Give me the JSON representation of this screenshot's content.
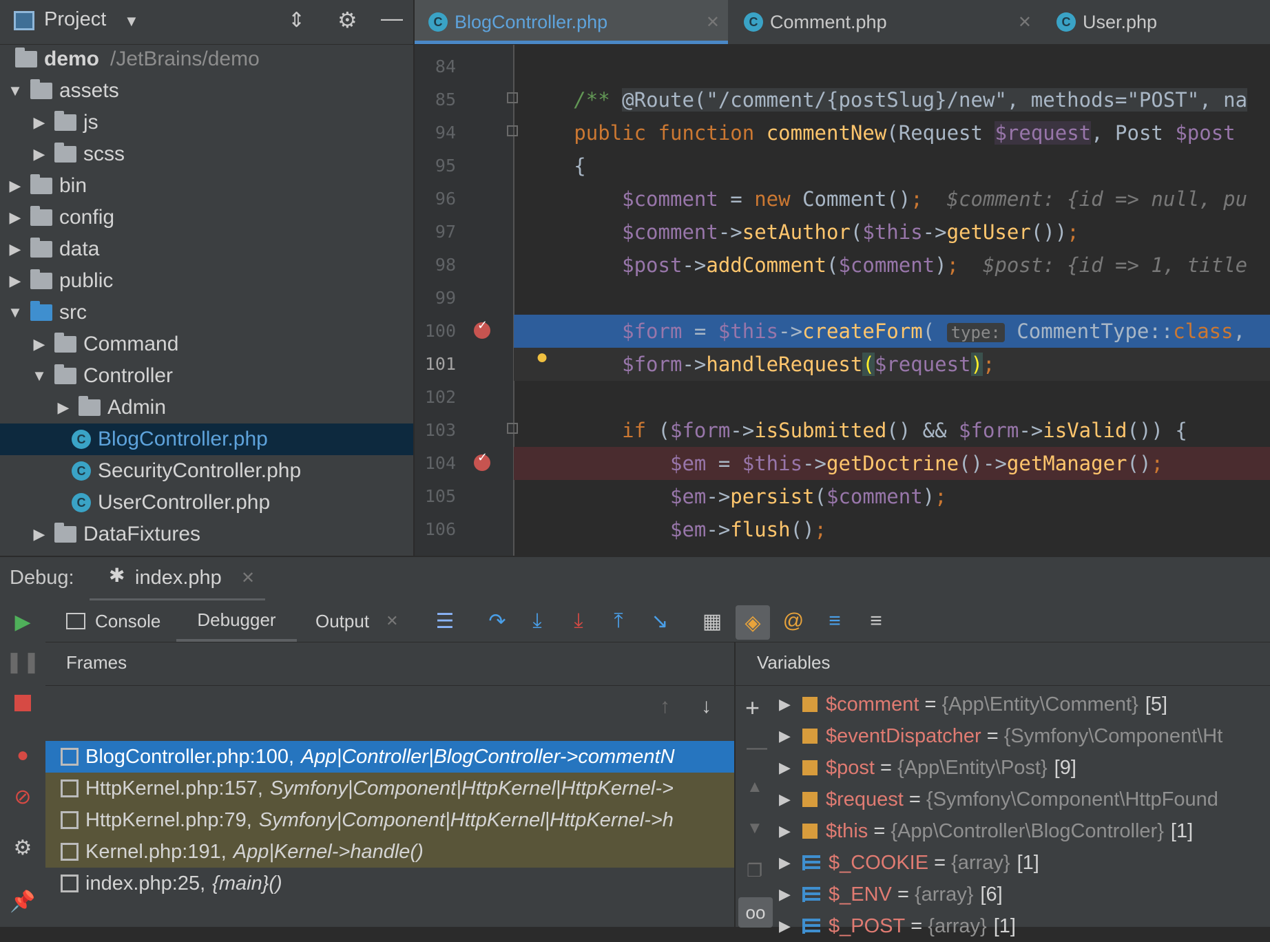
{
  "project_panel": {
    "title": "Project",
    "root": {
      "name": "demo",
      "path": "/JetBrains/demo"
    },
    "tree": [
      {
        "label": "assets",
        "expanded": true,
        "depth": 0
      },
      {
        "label": "js",
        "expanded": false,
        "depth": 1
      },
      {
        "label": "scss",
        "expanded": false,
        "depth": 1
      },
      {
        "label": "bin",
        "expanded": false,
        "depth": 0
      },
      {
        "label": "config",
        "expanded": false,
        "depth": 0
      },
      {
        "label": "data",
        "expanded": false,
        "depth": 0
      },
      {
        "label": "public",
        "expanded": false,
        "depth": 0
      },
      {
        "label": "src",
        "expanded": true,
        "depth": 0
      },
      {
        "label": "Command",
        "expanded": false,
        "depth": 1
      },
      {
        "label": "Controller",
        "expanded": true,
        "depth": 1
      },
      {
        "label": "Admin",
        "expanded": false,
        "depth": 2
      },
      {
        "label": "BlogController.php",
        "file": true,
        "depth": 2,
        "selected": true
      },
      {
        "label": "SecurityController.php",
        "file": true,
        "depth": 2
      },
      {
        "label": "UserController.php",
        "file": true,
        "depth": 2
      },
      {
        "label": "DataFixtures",
        "expanded": false,
        "depth": 1
      }
    ]
  },
  "editor": {
    "tabs": [
      {
        "label": "BlogController.php",
        "active": true
      },
      {
        "label": "Comment.php",
        "active": false
      },
      {
        "label": "User.php",
        "active": false
      }
    ],
    "line_numbers": [
      "84",
      "85",
      "94",
      "95",
      "96",
      "97",
      "98",
      "99",
      "100",
      "101",
      "102",
      "103",
      "104",
      "105",
      "106"
    ],
    "current_line": "101",
    "param_hint": "type:"
  },
  "debug": {
    "title": "Debug:",
    "session_tab": "index.php",
    "tabs": {
      "console": "Console",
      "debugger": "Debugger",
      "output": "Output"
    },
    "frames_header": "Frames",
    "variables_header": "Variables",
    "frames": [
      {
        "file": "BlogController.php:100,",
        "method": "App|Controller|BlogController->commentN",
        "state": "selected"
      },
      {
        "file": "HttpKernel.php:157,",
        "method": "Symfony|Component|HttpKernel|HttpKernel->",
        "state": "library"
      },
      {
        "file": "HttpKernel.php:79,",
        "method": "Symfony|Component|HttpKernel|HttpKernel->h",
        "state": "library"
      },
      {
        "file": "Kernel.php:191,",
        "method": "App|Kernel->handle()",
        "state": "library"
      },
      {
        "file": "index.php:25,",
        "method": "{main}()",
        "state": "normal"
      }
    ],
    "variables": [
      {
        "name": "$comment",
        "type": "{App\\Entity\\Comment}",
        "count": "[5]",
        "kind": "object"
      },
      {
        "name": "$eventDispatcher",
        "type": "{Symfony\\Component\\Ht",
        "count": "",
        "kind": "object"
      },
      {
        "name": "$post",
        "type": "{App\\Entity\\Post}",
        "count": "[9]",
        "kind": "object"
      },
      {
        "name": "$request",
        "type": "{Symfony\\Component\\HttpFound",
        "count": "",
        "kind": "object"
      },
      {
        "name": "$this",
        "type": "{App\\Controller\\BlogController}",
        "count": "[1]",
        "kind": "object"
      },
      {
        "name": "$_COOKIE",
        "type": "{array}",
        "count": "[1]",
        "kind": "array"
      },
      {
        "name": "$_ENV",
        "type": "{array}",
        "count": "[6]",
        "kind": "array"
      },
      {
        "name": "$_POST",
        "type": "{array}",
        "count": "[1]",
        "kind": "array"
      }
    ]
  },
  "colors": {
    "accent": "#4a88c7",
    "selection": "#2675bf",
    "breakpoint": "#c75450",
    "keyword": "#cc7832",
    "variable": "#9876aa",
    "function": "#ffc66d"
  }
}
